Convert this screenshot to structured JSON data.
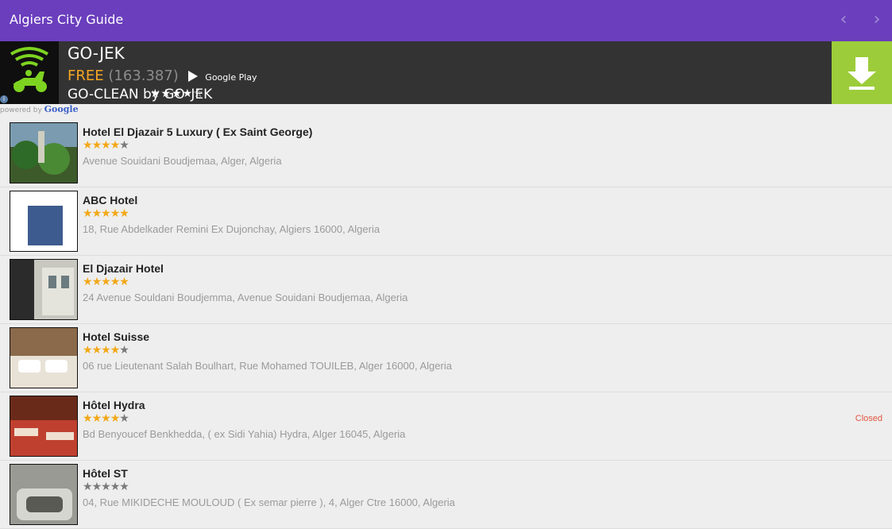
{
  "appbar": {
    "title": "Algiers City Guide"
  },
  "ad": {
    "app_name": "GO-JEK",
    "price": "FREE",
    "rating_stars": "★★★★☆",
    "rating_count": "(163.387)",
    "store": "Google Play",
    "subtitle": "GO-CLEAN by GO-JEK",
    "info_glyph": "i"
  },
  "powered": {
    "prefix": "powered by",
    "brand": "Google"
  },
  "hotels": [
    {
      "name": "Hotel El Djazair 5 Luxury ( Ex Saint George)",
      "rating": 4.0,
      "address": "Avenue Souidani Boudjemaa, Alger, Algeria",
      "status": ""
    },
    {
      "name": "ABC Hotel",
      "rating": 4.5,
      "address": "18, Rue Abdelkader Remini Ex Dujonchay, Algiers 16000, Algeria",
      "status": ""
    },
    {
      "name": "El Djazair Hotel",
      "rating": 4.5,
      "address": "24 Avenue Souldani Boudjemma, Avenue Souidani Boudjemaa, Algeria",
      "status": ""
    },
    {
      "name": "Hotel Suisse",
      "rating": 4.0,
      "address": "06 rue Lieutenant Salah Boulhart, Rue Mohamed TOUILEB, Alger 16000, Algeria",
      "status": ""
    },
    {
      "name": "Hôtel Hydra",
      "rating": 3.5,
      "address": "Bd Benyoucef Benkhedda, ( ex Sidi Yahia) Hydra, Alger 16045, Algeria",
      "status": "Closed"
    },
    {
      "name": "Hôtel ST",
      "rating": 0,
      "address": "04, Rue MIKIDECHE MOULOUD ( Ex semar pierre ), 4, Alger Ctre 16000, Algeria",
      "status": ""
    }
  ],
  "colors": {
    "appbar": "#6a3ebd",
    "ad_bg": "#333333",
    "download": "#9ccc3a",
    "star_on": "#f2a817",
    "closed": "#e2553f"
  }
}
